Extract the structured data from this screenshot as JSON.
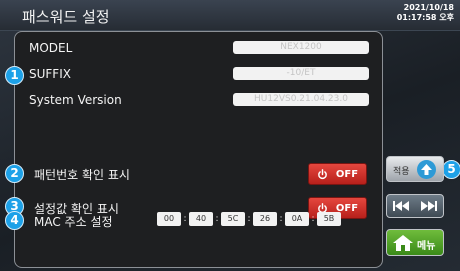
{
  "header": {
    "title": "패스워드 설정",
    "date": "2021/10/18",
    "time": "01:17:58 오후"
  },
  "info": {
    "model_label": "MODEL",
    "model_value": "NEX1200",
    "suffix_label": "SUFFIX",
    "suffix_value": "-10/ET",
    "version_label": "System Version",
    "version_value": "HU12VS0.21.04.23.0"
  },
  "options": {
    "pattern_label": "패턴번호 확인 표시",
    "pattern_state": "OFF",
    "setting_label": "설정값 확인 표시",
    "setting_state": "OFF"
  },
  "mac": {
    "label": "MAC 주소 설정",
    "octets": [
      "00",
      "40",
      "5C",
      "26",
      "0A",
      "5B"
    ]
  },
  "side": {
    "apply_label": "적용",
    "menu_label": "메뉴"
  },
  "badges": [
    "1",
    "2",
    "3",
    "4",
    "5"
  ],
  "colors": {
    "badge": "#1da1e8",
    "toggle_off": "#d8332b",
    "menu_button": "#4fa127"
  }
}
